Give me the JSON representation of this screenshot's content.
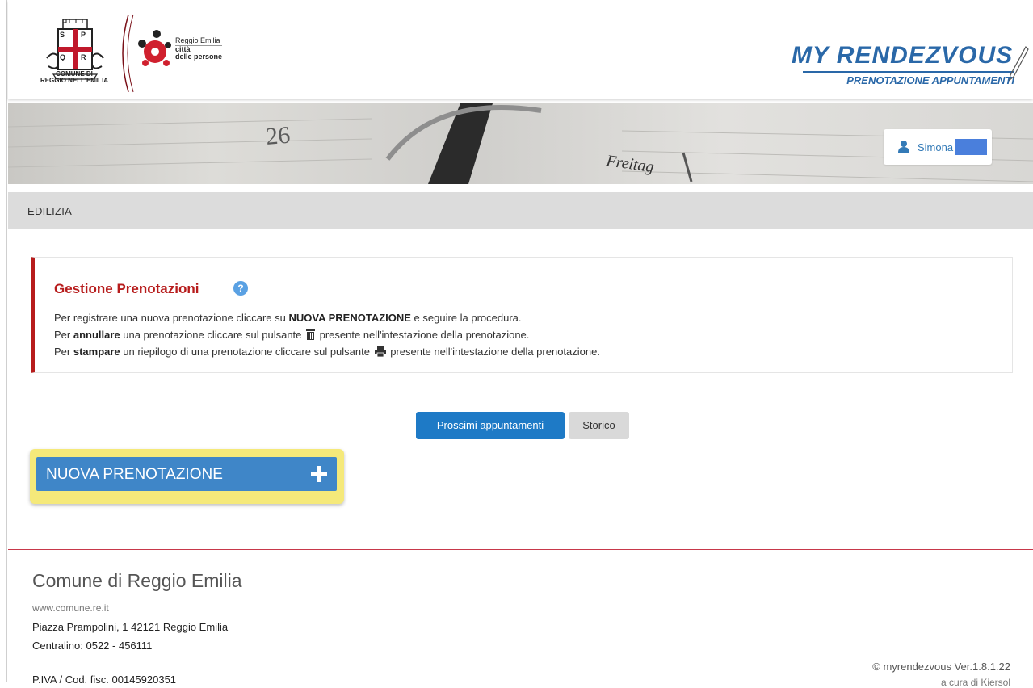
{
  "header": {
    "comune_caption_line1": "COMUNE DI",
    "comune_caption_line2": "REGGIO NELL'EMILIA",
    "re_logo_line1": "Reggio Emilia",
    "re_logo_line2": "città",
    "re_logo_line3": "delle persone",
    "app_title": "MY RENDEZVOUS",
    "app_subtitle": "PRENOTAZIONE APPUNTAMENTI",
    "crest_letters": [
      "S",
      "P",
      "Q",
      "R"
    ]
  },
  "banner": {
    "user_name": "Simona F"
  },
  "section": {
    "title": "EDILIZIA"
  },
  "info": {
    "title": "Gestione Prenotazioni",
    "line1_pre": "Per registrare una nuova prenotazione cliccare su ",
    "line1_bold": "NUOVA PRENOTAZIONE",
    "line1_post": " e seguire la procedura.",
    "line2_pre": "Per ",
    "line2_bold": "annullare",
    "line2_mid": " una prenotazione cliccare sul pulsante ",
    "line2_post": " presente nell'intestazione della prenotazione.",
    "line3_pre": "Per ",
    "line3_bold": "stampare",
    "line3_mid": " un riepilogo di una prenotazione cliccare sul pulsante ",
    "line3_post": " presente nell'intestazione della prenotazione."
  },
  "tabs": {
    "next_label": "Prossimi appuntamenti",
    "history_label": "Storico"
  },
  "new_booking": {
    "label": "NUOVA PRENOTAZIONE"
  },
  "footer": {
    "title": "Comune di Reggio Emilia",
    "website": "www.comune.re.it",
    "address": "Piazza Prampolini, 1 42121 Reggio Emilia",
    "phone_label": "Centralino:",
    "phone_value": " 0522 - 456111",
    "piva": "P.IVA / Cod. fisc. 00145920351",
    "version": "© myrendezvous Ver.1.8.1.22",
    "credit": "a cura di Kiersol"
  },
  "colors": {
    "brand_blue": "#2a68a8",
    "accent_red": "#b71c1c",
    "primary_button": "#1e7ac6",
    "highlight_yellow": "#f5e97a"
  }
}
